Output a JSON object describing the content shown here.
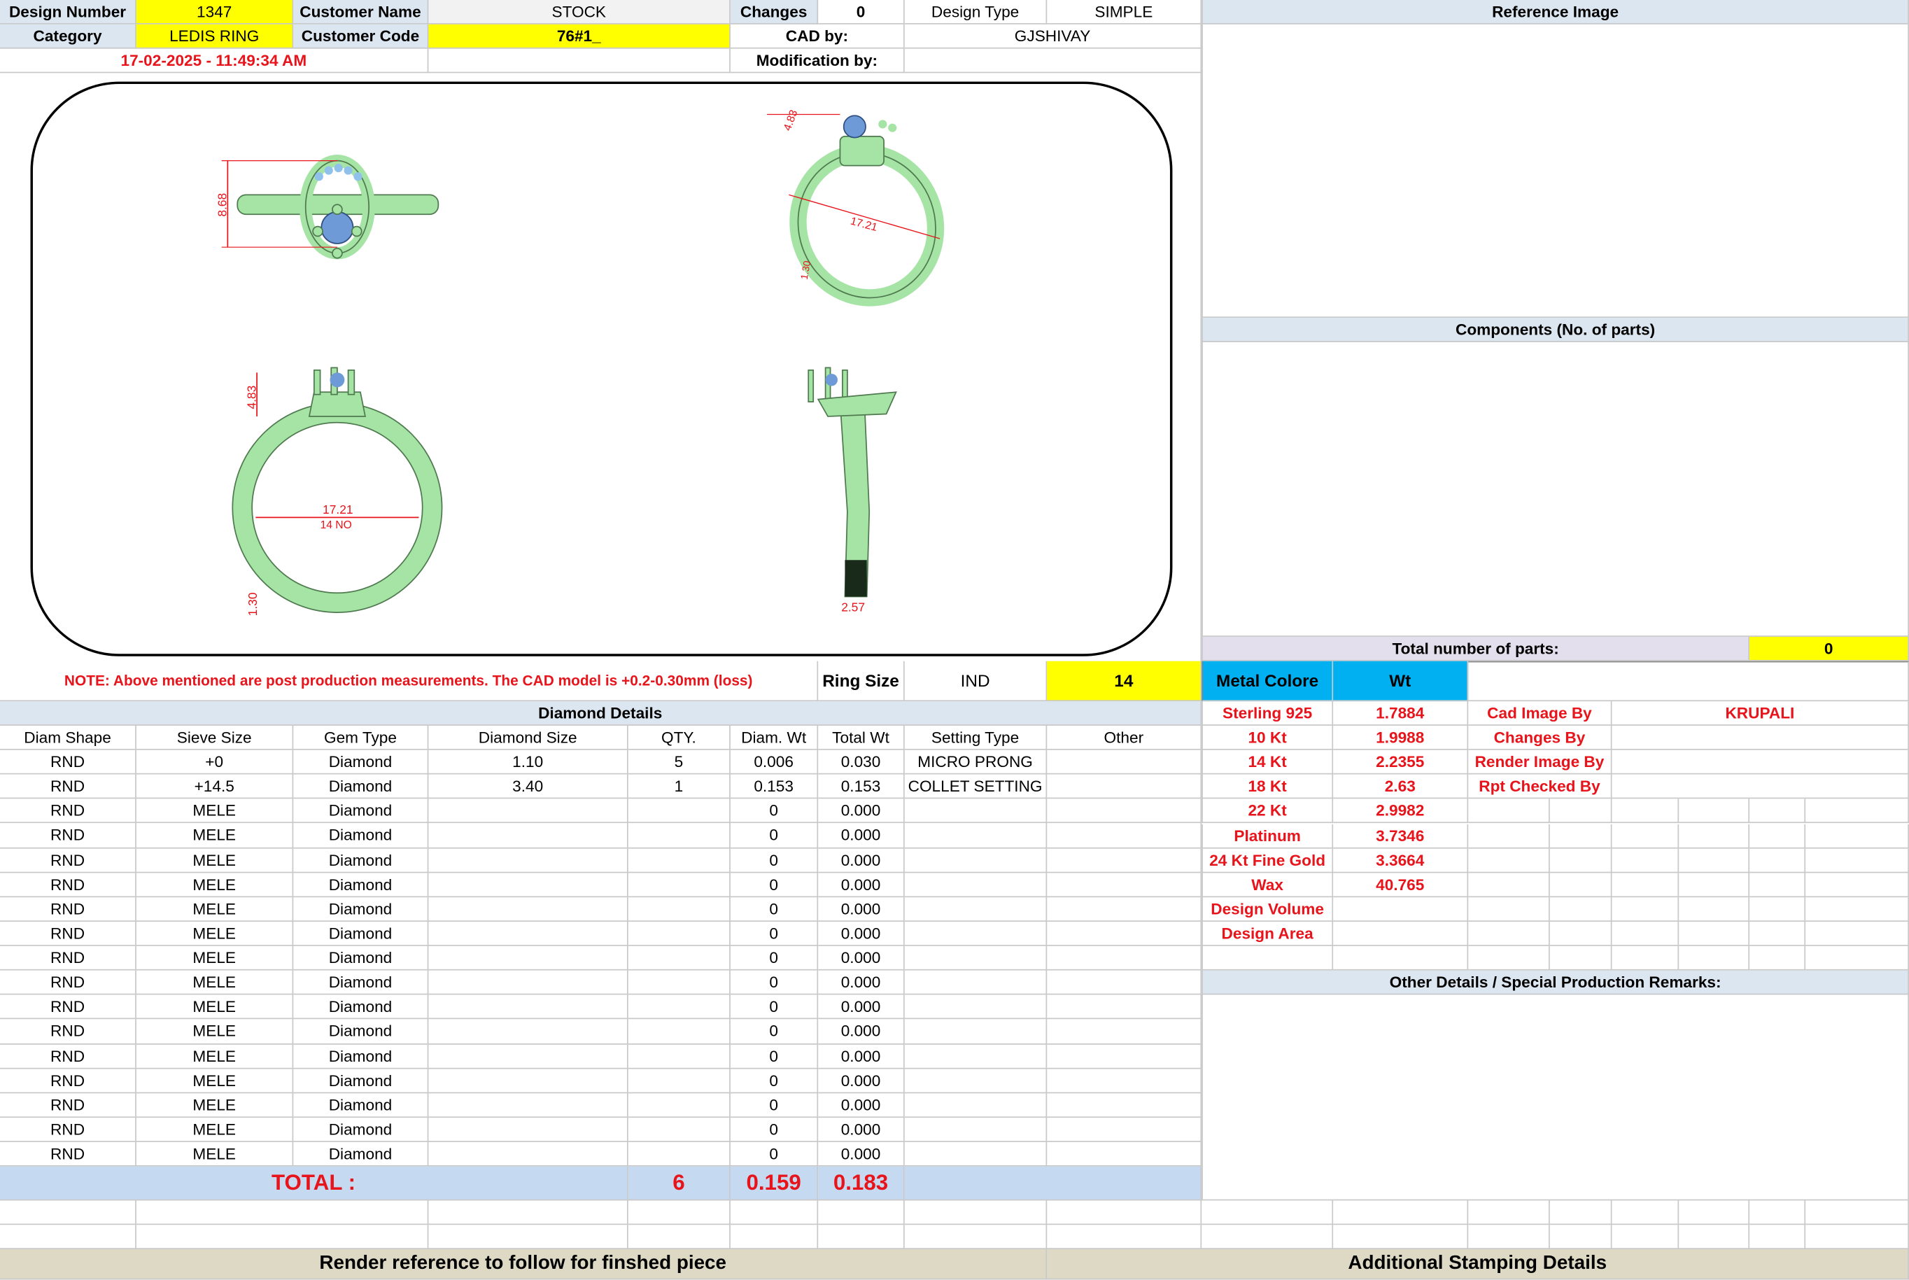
{
  "header": {
    "design_number_label": "Design Number",
    "design_number": "1347",
    "customer_name_label": "Customer Name",
    "customer_name": "STOCK",
    "changes_label": "Changes",
    "changes": "0",
    "design_type_label": "Design Type",
    "design_type": "SIMPLE",
    "category_label": "Category",
    "category": "LEDIS RING",
    "customer_code_label": "Customer Code",
    "customer_code": "76#1_",
    "cad_by_label": "CAD by:",
    "cad_by": "GJSHIVAY",
    "datetime": "17-02-2025 - 11:49:34 AM",
    "modification_by_label": "Modification by:"
  },
  "reference_image_label": "Reference Image",
  "components_label": "Components (No. of parts)",
  "total_parts_label": "Total number of parts:",
  "total_parts": "0",
  "measurements": {
    "top_height": "8.68",
    "top_right_a": "4.83",
    "top_right_b": "17.21",
    "top_right_c": "1.30",
    "front_height": "4.83",
    "front_inner": "17.21",
    "front_size": "14 NO",
    "front_band": "1.30",
    "side_width": "2.57"
  },
  "note": "NOTE: Above mentioned are post production measurements. The CAD model is +0.2-0.30mm (loss)",
  "ring_size_label": "Ring Size",
  "ring_size_system": "IND",
  "ring_size": "14",
  "diamond": {
    "title": "Diamond Details",
    "columns": [
      "Diam Shape",
      "Sieve Size",
      "Gem Type",
      "Diamond Size",
      "QTY.",
      "Diam. Wt",
      "Total Wt",
      "Setting Type",
      "Other"
    ],
    "rows": [
      [
        "RND",
        "+0",
        "Diamond",
        "1.10",
        "5",
        "0.006",
        "0.030",
        "MICRO PRONG",
        ""
      ],
      [
        "RND",
        "+14.5",
        "Diamond",
        "3.40",
        "1",
        "0.153",
        "0.153",
        "COLLET SETTING",
        ""
      ],
      [
        "RND",
        "MELE",
        "Diamond",
        "",
        "",
        "0",
        "0.000",
        "",
        ""
      ],
      [
        "RND",
        "MELE",
        "Diamond",
        "",
        "",
        "0",
        "0.000",
        "",
        ""
      ],
      [
        "RND",
        "MELE",
        "Diamond",
        "",
        "",
        "0",
        "0.000",
        "",
        ""
      ],
      [
        "RND",
        "MELE",
        "Diamond",
        "",
        "",
        "0",
        "0.000",
        "",
        ""
      ],
      [
        "RND",
        "MELE",
        "Diamond",
        "",
        "",
        "0",
        "0.000",
        "",
        ""
      ],
      [
        "RND",
        "MELE",
        "Diamond",
        "",
        "",
        "0",
        "0.000",
        "",
        ""
      ],
      [
        "RND",
        "MELE",
        "Diamond",
        "",
        "",
        "0",
        "0.000",
        "",
        ""
      ],
      [
        "RND",
        "MELE",
        "Diamond",
        "",
        "",
        "0",
        "0.000",
        "",
        ""
      ],
      [
        "RND",
        "MELE",
        "Diamond",
        "",
        "",
        "0",
        "0.000",
        "",
        ""
      ],
      [
        "RND",
        "MELE",
        "Diamond",
        "",
        "",
        "0",
        "0.000",
        "",
        ""
      ],
      [
        "RND",
        "MELE",
        "Diamond",
        "",
        "",
        "0",
        "0.000",
        "",
        ""
      ],
      [
        "RND",
        "MELE",
        "Diamond",
        "",
        "",
        "0",
        "0.000",
        "",
        ""
      ],
      [
        "RND",
        "MELE",
        "Diamond",
        "",
        "",
        "0",
        "0.000",
        "",
        ""
      ],
      [
        "RND",
        "MELE",
        "Diamond",
        "",
        "",
        "0",
        "0.000",
        "",
        ""
      ],
      [
        "RND",
        "MELE",
        "Diamond",
        "",
        "",
        "0",
        "0.000",
        "",
        ""
      ]
    ],
    "total_label": "TOTAL :",
    "total_qty": "6",
    "total_diam_wt": "0.159",
    "total_wt": "0.183"
  },
  "metal": {
    "color_label": "Metal Colore",
    "wt_label": "Wt",
    "rows": [
      [
        "Sterling 925",
        "1.7884"
      ],
      [
        "10 Kt",
        "1.9988"
      ],
      [
        "14 Kt",
        "2.2355"
      ],
      [
        "18 Kt",
        "2.63"
      ],
      [
        "22 Kt",
        "2.9982"
      ],
      [
        "Platinum",
        "3.7346"
      ],
      [
        "24 Kt Fine Gold",
        "3.3664"
      ],
      [
        "Wax",
        "40.765"
      ],
      [
        "Design Volume",
        ""
      ],
      [
        "Design Area",
        ""
      ]
    ]
  },
  "people": [
    [
      "Cad Image By",
      "KRUPALI"
    ],
    [
      "Changes By",
      ""
    ],
    [
      "Render Image By",
      ""
    ],
    [
      "Rpt Checked By",
      ""
    ]
  ],
  "other_details_label": "Other Details / Special Production Remarks:",
  "render_reference_label": "Render reference to follow for finshed piece",
  "stamping_label": "Additional Stamping Details",
  "colors": {
    "ring": "#a6e4a6",
    "stone": "#6f9ad8",
    "dimension": "#e8141b",
    "highlight": "#ffff00"
  }
}
